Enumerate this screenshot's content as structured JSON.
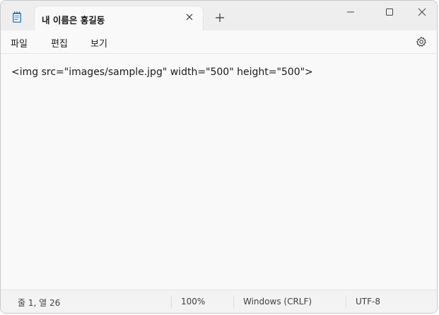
{
  "tab": {
    "title": "내 이름은 홍길동"
  },
  "menu": {
    "file": "파일",
    "edit": "편집",
    "view": "보기"
  },
  "editor": {
    "content": "<img src=\"images/sample.jpg\" width=\"500\" height=\"500\">"
  },
  "status": {
    "position": "줄 1, 열 26",
    "zoom": "100%",
    "line_ending": "Windows (CRLF)",
    "encoding": "UTF-8"
  },
  "icons": {
    "app": "notepad-icon",
    "close_tab": "close-icon",
    "new_tab": "plus-icon",
    "minimize": "minimize-icon",
    "maximize": "maximize-icon",
    "close_window": "close-icon",
    "settings": "gear-icon"
  },
  "colors": {
    "accent": "#0067c0",
    "titlebar": "#eeeeee",
    "background": "#f9f9f9"
  }
}
